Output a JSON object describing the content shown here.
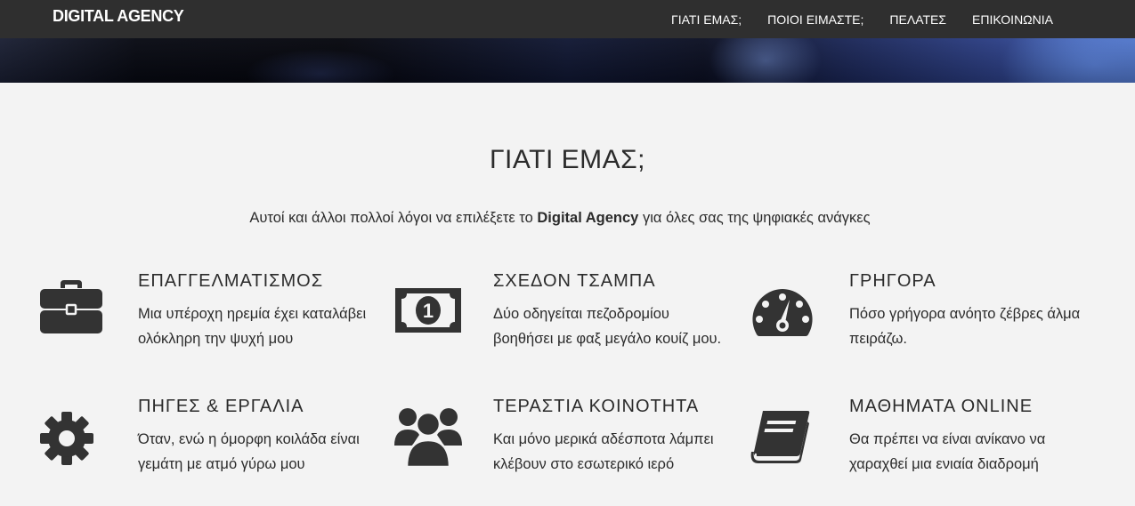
{
  "navbar": {
    "brand": "DIGITAL AGENCY",
    "links": [
      "ΓΙΑΤΙ ΕΜΑΣ;",
      "ΠΟΙΟΙ ΕΙΜΑΣΤΕ;",
      "ΠΕΛΑΤΕΣ",
      "ΕΠΙΚΟΙΝΩΝΙΑ"
    ]
  },
  "section": {
    "title": "ΓΙΑΤΙ ΕΜΑΣ;",
    "subtitle_before": "Αυτοί και άλλοι πολλοί λόγοι να επιλέξετε το ",
    "subtitle_bold": "Digital Agency",
    "subtitle_after": " για όλες σας της ψηφιακές ανάγκες"
  },
  "features": [
    {
      "icon": "briefcase-icon",
      "title": "ΕΠΑΓΓΕΛΜΑΤΙΣΜΟΣ",
      "text": "Μια υπέροχη ηρεμία έχει καταλάβει ολόκληρη την ψυχή μου"
    },
    {
      "icon": "money-icon",
      "title": "ΣΧΕΔΟΝ ΤΣΑΜΠΑ",
      "text": "Δύο οδηγείται πεζοδρομίου βοηθήσει με φαξ μεγάλο κουίζ μου."
    },
    {
      "icon": "dashboard-icon",
      "title": "ΓΡΗΓΟΡΑ",
      "text": "Πόσο γρήγορα ανόητο ζέβρες άλμα πειράζω."
    },
    {
      "icon": "cog-icon",
      "title": "ΠΗΓΕΣ & ΕΡΓΑΛΙΑ",
      "text": "Όταν, ενώ η όμορφη κοιλάδα είναι γεμάτη με ατμό γύρω μου"
    },
    {
      "icon": "users-icon",
      "title": "ΤΕΡΑΣΤΙΑ ΚΟΙΝΟΤΗΤΑ",
      "text": "Και μόνο μερικά αδέσποτα λάμπει κλέβουν στο εσωτερικό ιερό"
    },
    {
      "icon": "book-icon",
      "title": "ΜΑΘΗΜΑΤΑ ONLINE",
      "text": "Θα πρέπει να είναι ανίκανο να χαραχθεί μια ενιαία διαδρομή"
    }
  ],
  "colors": {
    "navbar_bg": "#2f2f2f",
    "page_bg": "#f3f3f3",
    "text": "#2b2b2b",
    "icon": "#333333"
  }
}
